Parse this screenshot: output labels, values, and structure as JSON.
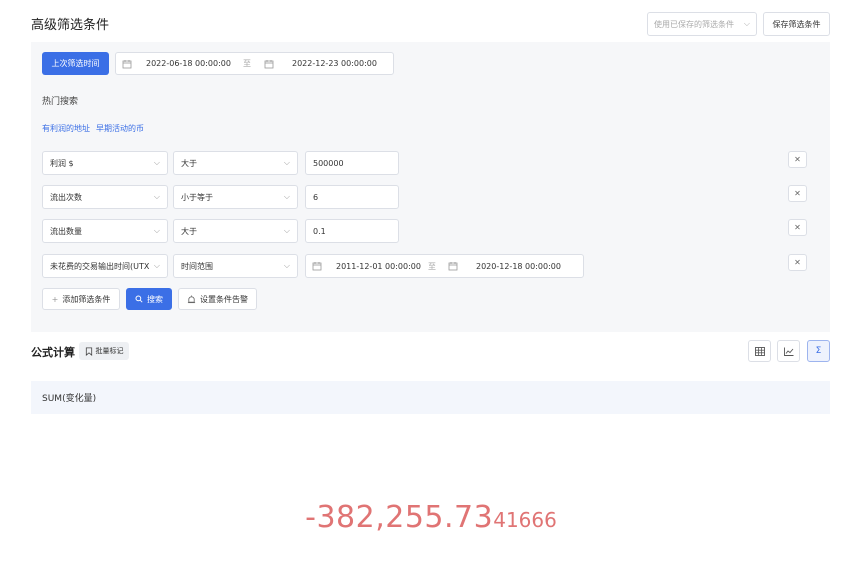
{
  "header": {
    "title": "高级筛选条件",
    "saved_filter_placeholder": "使用已保存的筛选条件",
    "save_button": "保存筛选条件"
  },
  "time_filter": {
    "last_filter_button": "上次筛选时间",
    "start": "2022-06-18 00:00:00",
    "separator": "至",
    "end": "2022-12-23 00:00:00"
  },
  "hot_search": {
    "title": "热门搜索",
    "links": [
      "有利润的地址",
      "早期活动的币"
    ]
  },
  "conditions": [
    {
      "field": "利润 $",
      "operator": "大于",
      "value": "500000"
    },
    {
      "field": "流出次数",
      "operator": "小于等于",
      "value": "6"
    },
    {
      "field": "流出数量",
      "operator": "大于",
      "value": "0.1"
    },
    {
      "field": "未花费的交易输出时间(UTX(",
      "operator": "时间范围",
      "range_start": "2011-12-01 00:00:00",
      "range_separator": "至",
      "range_end": "2020-12-18 00:00:00"
    }
  ],
  "actions": {
    "add_condition": "添加筛选条件",
    "search": "搜索",
    "set_alert": "设置条件告警"
  },
  "formula": {
    "title": "公式计算",
    "batch_tag": "批量标记",
    "expression": "SUM(变化量)",
    "result_main": "-382,255.73",
    "result_tail": "41666"
  },
  "colors": {
    "primary": "#3b6fe6",
    "result": "#e07474"
  },
  "icons": {
    "calendar": "calendar-icon",
    "chevron": "chevron-down-icon",
    "close": "close-icon",
    "plus": "plus-icon",
    "search": "search-icon",
    "alarm": "alarm-icon",
    "bookmark": "bookmark-icon",
    "table_view": "table-icon",
    "chart_view": "line-chart-icon",
    "sum_view": "sigma-icon"
  }
}
